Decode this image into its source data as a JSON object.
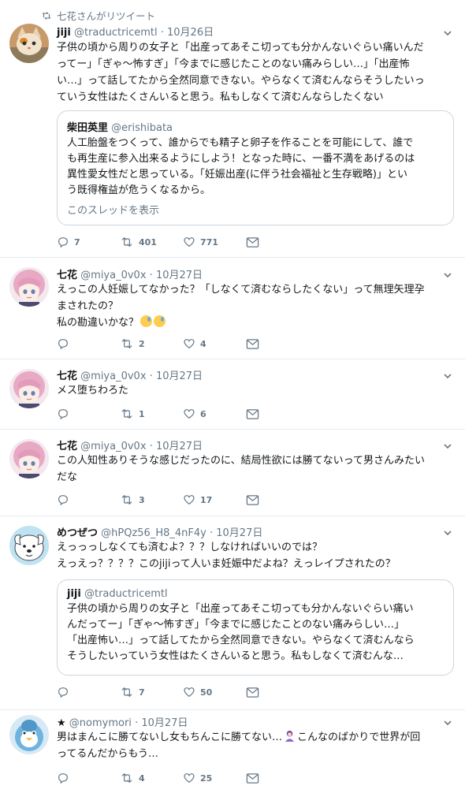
{
  "retweet_header": "七花さんがリツイート",
  "tweets": [
    {
      "name": "jiji",
      "handle": "@traductricemtl",
      "date": "10月26日",
      "lines": [
        "子供の頃から周りの女子と「出産ってあそこ切っても分かんないぐらい痛いんだ",
        "ってー」「ぎゃ～怖すぎ」「今までに感じたことのない痛みらしい…」「出産怖",
        "い…」って話してたから全然同意できない。やらなくて済むんならそうしたいっ",
        "ていう女性はたくさんいると思う。私もしなくて済むんならしたくない"
      ],
      "quote": {
        "name": "柴田英里",
        "handle": "@erishibata",
        "lines": [
          "人工胎盤をつくって、誰からでも精子と卵子を作ることを可能にして、誰で",
          "も再生産に参入出来るようにしよう！となった時に、一番不満をあげるのは",
          "異性愛女性だと思っている。「妊娠出産(に伴う社会福祉と生存戦略)」とい",
          "う既得権益が危うくなるから。"
        ],
        "thread_link": "このスレッドを表示"
      },
      "replies": "7",
      "retweets": "401",
      "likes": "771"
    },
    {
      "name": "七花",
      "handle": "@miya_0v0x",
      "date": "10月27日",
      "lines": [
        "えっこの人妊娠してなかった？「しなくて済むならしたくない」って無理矢理孕",
        "まされたの？",
        "私の勘違いかな？"
      ],
      "replies": "",
      "retweets": "2",
      "likes": "4"
    },
    {
      "name": "七花",
      "handle": "@miya_0v0x",
      "date": "10月27日",
      "lines": [
        "メス堕ちわろた"
      ],
      "replies": "",
      "retweets": "1",
      "likes": "6"
    },
    {
      "name": "七花",
      "handle": "@miya_0v0x",
      "date": "10月27日",
      "lines": [
        "この人知性ありそうな感じだったのに、結局性欲には勝てないって男さんみたい",
        "だな"
      ],
      "replies": "",
      "retweets": "3",
      "likes": "17"
    },
    {
      "name": "めつぜつ",
      "handle": "@hPQz56_H8_4nF4y",
      "date": "10月27日",
      "lines": [
        "えっっっしなくても済むよ？？？しなければいいのでは？",
        "えっえっ？？？？このjijiって人いま妊娠中だよね？えっレイプされたの？"
      ],
      "quote": {
        "name": "jiji",
        "handle": "@traductricemtl",
        "lines": [
          "子供の頃から周りの女子と「出産ってあそこ切っても分かんないぐらい痛い",
          "んだってー」「ぎゃ～怖すぎ」「今までに感じたことのない痛みらしい…」",
          "「出産怖い…」って話してたから全然同意できない。やらなくて済むんなら",
          "そうしたいっていう女性はたくさんいると思う。私もしなくて済むんな…"
        ]
      },
      "replies": "",
      "retweets": "7",
      "likes": "50"
    },
    {
      "name": "★",
      "handle": "@nomymori",
      "date": "10月27日",
      "line1_a": "男はまんこに勝てないし女もちんこに勝てない…",
      "line1_b": "こんなのばかりで世界が回",
      "line2": "ってるんだからもう…",
      "replies": "",
      "retweets": "4",
      "likes": "25"
    }
  ],
  "colors": {
    "accent": "#1da1f2",
    "text": "#14171a",
    "muted": "#657786",
    "border": "#e6ecf0"
  },
  "icons": [
    "retweet-icon",
    "reply-icon",
    "heart-icon",
    "envelope-icon",
    "chevron-down-icon"
  ]
}
